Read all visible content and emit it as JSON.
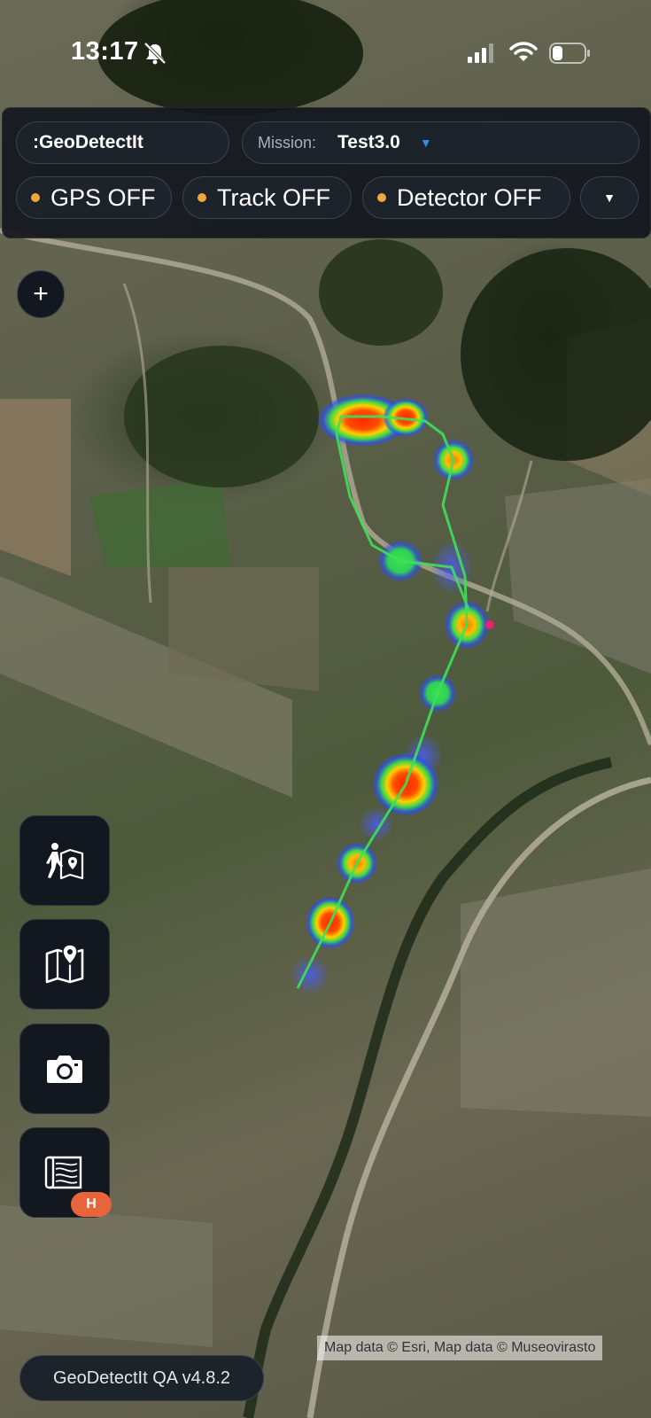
{
  "status_bar": {
    "time": "13:17",
    "icons": [
      "bell-slash-icon",
      "signal-icon",
      "wifi-icon",
      "battery-icon"
    ]
  },
  "header": {
    "app_name": ":GeoDetectIt",
    "mission_label": "Mission:",
    "mission_value": "Test3.0",
    "mission_caret": "▼",
    "status_pills": {
      "gps": "GPS OFF",
      "track": "Track OFF",
      "detector": "Detector OFF"
    },
    "more_caret": "▼",
    "status_dot_color": "#f2a73b",
    "accent_color": "#2d8cf0"
  },
  "map": {
    "zoom_in_label": "+",
    "attribution": "Map data © Esri, Map data © Museovirasto"
  },
  "tools": {
    "items": [
      {
        "icon": "hiker-map-icon"
      },
      {
        "icon": "map-pin-icon"
      },
      {
        "icon": "camera-icon"
      },
      {
        "icon": "layers-map-icon",
        "badge": "H",
        "badge_color": "#e8643a"
      }
    ]
  },
  "footer": {
    "version": "GeoDetectIt QA v4.8.2"
  }
}
